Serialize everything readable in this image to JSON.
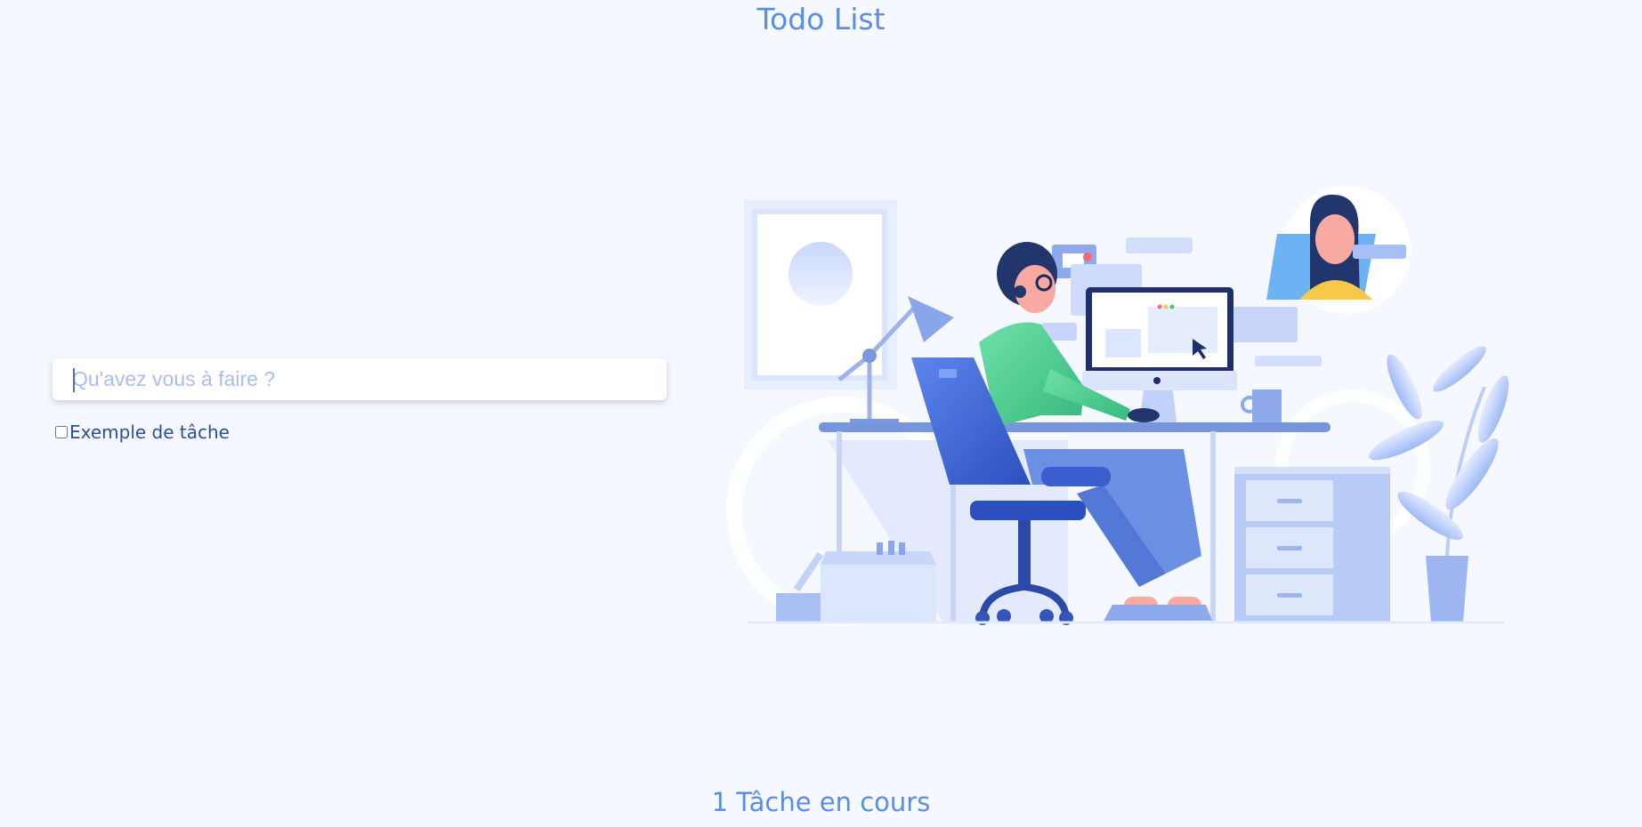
{
  "header": {
    "title": "Todo List"
  },
  "new_task": {
    "placeholder": "Qu'avez vous à faire ?",
    "value": ""
  },
  "tasks": [
    {
      "label": "Exemple de tâche",
      "done": false
    }
  ],
  "footer": {
    "status": "1 Tâche en cours"
  },
  "colors": {
    "accent": "#5b8ee2",
    "background": "#f5f8fe",
    "task_text": "#2a4ea5"
  }
}
